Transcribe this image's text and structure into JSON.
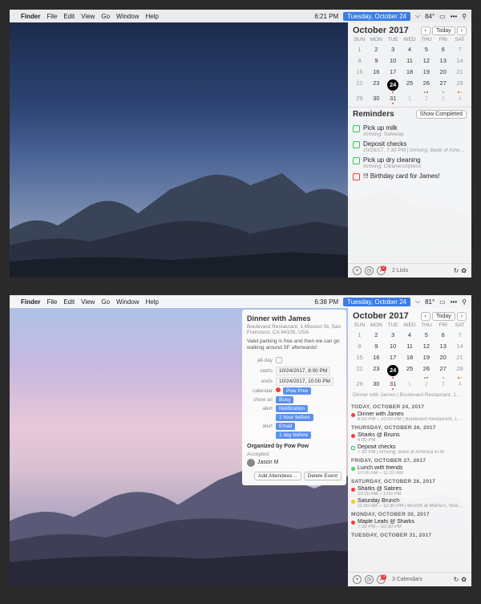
{
  "menu": {
    "app": "Finder",
    "items": [
      "File",
      "Edit",
      "View",
      "Go",
      "Window",
      "Help"
    ]
  },
  "top": {
    "time": "6:21 PM",
    "date": "Tuesday, October 24",
    "temp": "84°",
    "cal": {
      "title": "October 2017",
      "today_btn": "Today",
      "dow": [
        "SUN",
        "MON",
        "TUE",
        "WED",
        "THU",
        "FRI",
        "SAT"
      ],
      "days": [
        1,
        2,
        3,
        4,
        5,
        6,
        7,
        8,
        9,
        10,
        11,
        12,
        13,
        14,
        15,
        16,
        17,
        18,
        19,
        20,
        21,
        22,
        23,
        24,
        25,
        26,
        27,
        28,
        29,
        30,
        31,
        1,
        2,
        3,
        4
      ],
      "today_idx": 23,
      "trailing_from": 31
    },
    "reminders": {
      "title": "Reminders",
      "btn": "Show Completed",
      "items": [
        {
          "c": "#34c759",
          "t": "Pick up milk",
          "s": "Arriving: Safeway"
        },
        {
          "c": "#34c759",
          "t": "Deposit checks",
          "s": "10/26/17, 7:30 PM | Arriving: Bank of America…"
        },
        {
          "c": "#34c759",
          "t": "Pick up dry cleaning",
          "s": "Arriving: CleanersXpress"
        },
        {
          "c": "#ff3b30",
          "t": "!!! Birthday card for James!",
          "s": ""
        }
      ]
    },
    "footer": {
      "count": "2 Lists",
      "badge": "2"
    }
  },
  "bot": {
    "time": "6:38 PM",
    "date": "Tuesday, October 24",
    "temp": "81°",
    "cal": {
      "title": "October 2017",
      "today_btn": "Today",
      "dow": [
        "SUN",
        "MON",
        "TUE",
        "WED",
        "THU",
        "FRI",
        "SAT"
      ],
      "days": [
        1,
        2,
        3,
        4,
        5,
        6,
        7,
        8,
        9,
        10,
        11,
        12,
        13,
        14,
        15,
        16,
        17,
        18,
        19,
        20,
        21,
        22,
        23,
        24,
        25,
        26,
        27,
        28,
        29,
        30,
        31,
        1,
        2,
        3,
        4
      ],
      "today_idx": 23,
      "trailing_from": 31,
      "sub": "Dinner with James | Boulevard Restaurant, 1…"
    },
    "event": {
      "title": "Dinner with James",
      "loc": "Boulevard Restaurant, 1 Mission St, San Francisco, CA 94105, USA",
      "note": "Valet parking is free and then we can go walking around SF afterwards!",
      "allday": "all-day",
      "starts_l": "starts",
      "ends_l": "ends",
      "cal_l": "calendar",
      "show_l": "show as",
      "alert_l": "alert",
      "starts": "10/24/2017, 8:00 PM",
      "ends": "10/24/2017, 10:00 PM",
      "calendar": "Pow Pow",
      "showas": "Busy",
      "alert1": "Notification",
      "alert1b": "1 hour before",
      "alert2": "Email",
      "alert2b": "1 day before",
      "org": "Organized by Pow Pow",
      "acc": "Accepted",
      "person": "Jason M",
      "btn1": "Add Attendees…",
      "btn2": "Delete Event"
    },
    "agenda": [
      {
        "day": "TODAY, OCTOBER 24, 2017",
        "evs": [
          {
            "c": "#ff3b30",
            "t": "Dinner with James",
            "s": "8:00 PM – 10:00 PM | Boulevard Restaurant, 1…"
          }
        ]
      },
      {
        "day": "THURSDAY, OCTOBER 26, 2017",
        "evs": [
          {
            "c": "#ff3b30",
            "t": "Sharks @ Bruins",
            "s": "4:00 PM"
          },
          {
            "sq": "#34c759",
            "t": "Deposit checks",
            "s": "7:30 PM | Arriving: Bank of America ATM"
          }
        ]
      },
      {
        "day": "FRIDAY, OCTOBER 27, 2017",
        "evs": [
          {
            "c": "#4cd964",
            "t": "Lunch with friends",
            "s": "10:00 AM – 11:00 AM"
          }
        ]
      },
      {
        "day": "SATURDAY, OCTOBER 28, 2017",
        "evs": [
          {
            "c": "#ff3b30",
            "t": "Sharks @ Sabres",
            "s": "10:00 AM – 1:00 PM"
          },
          {
            "c": "#ffcc00",
            "t": "Saturday Brunch",
            "s": "11:00 AM – 12:30 PM | Brunch at Mama's, Stoc…"
          }
        ]
      },
      {
        "day": "MONDAY, OCTOBER 30, 2017",
        "evs": [
          {
            "c": "#ff3b30",
            "t": "Maple Leafs @ Sharks",
            "s": "7:30 PM – 10:30 PM"
          }
        ]
      },
      {
        "day": "TUESDAY, OCTOBER 31, 2017",
        "evs": []
      }
    ],
    "footer": {
      "count": "3 Calendars",
      "badge": "3"
    }
  }
}
